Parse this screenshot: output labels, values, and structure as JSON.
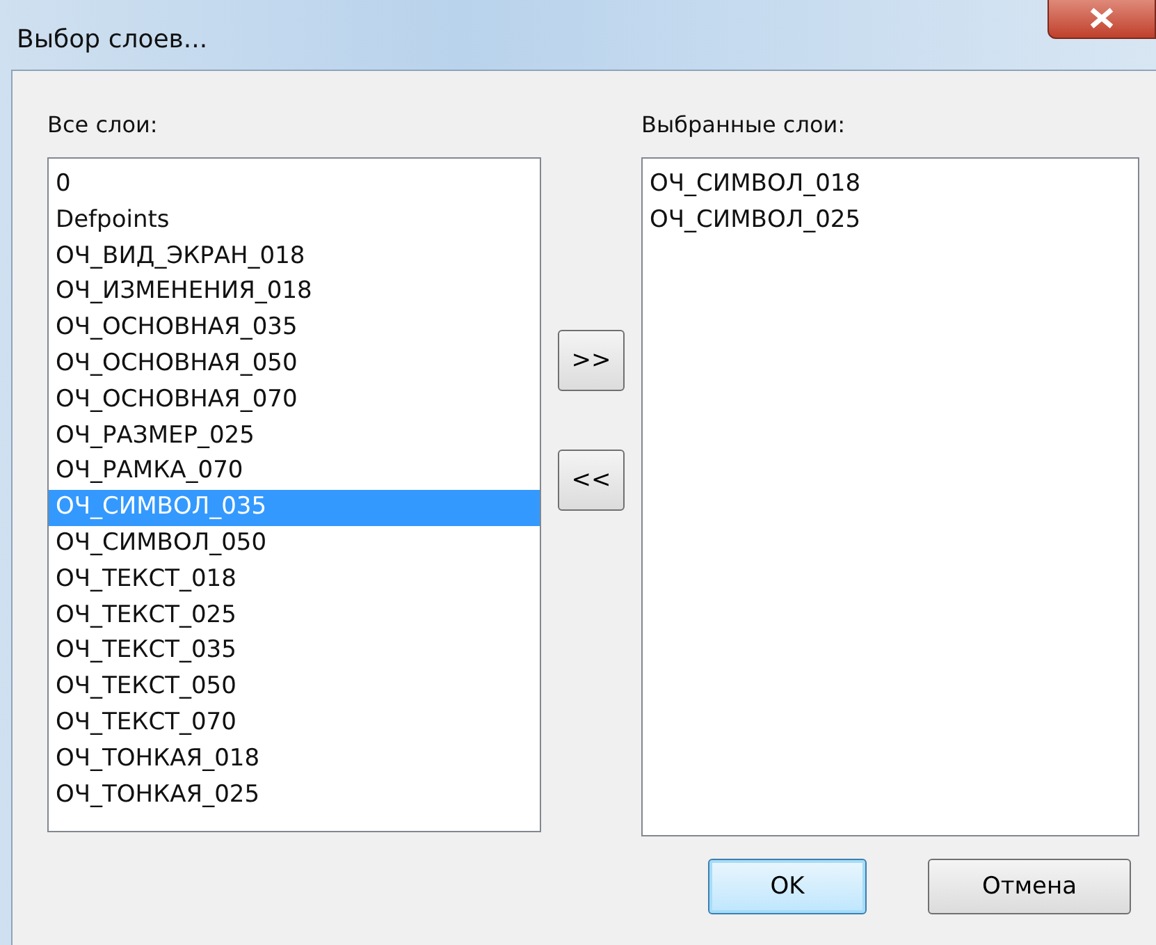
{
  "window": {
    "title": "Выбор слоев..."
  },
  "all_layers": {
    "label": "Все слои:",
    "items": [
      {
        "name": "0",
        "selected": false
      },
      {
        "name": "Defpoints",
        "selected": false
      },
      {
        "name": "ОЧ_ВИД_ЭКРАН_018",
        "selected": false
      },
      {
        "name": "ОЧ_ИЗМЕНЕНИЯ_018",
        "selected": false
      },
      {
        "name": "ОЧ_ОСНОВНАЯ_035",
        "selected": false
      },
      {
        "name": "ОЧ_ОСНОВНАЯ_050",
        "selected": false
      },
      {
        "name": "ОЧ_ОСНОВНАЯ_070",
        "selected": false
      },
      {
        "name": "ОЧ_РАЗМЕР_025",
        "selected": false
      },
      {
        "name": "ОЧ_РАМКА_070",
        "selected": false
      },
      {
        "name": "ОЧ_СИМВОЛ_035",
        "selected": true
      },
      {
        "name": "ОЧ_СИМВОЛ_050",
        "selected": false
      },
      {
        "name": "ОЧ_ТЕКСТ_018",
        "selected": false
      },
      {
        "name": "ОЧ_ТЕКСТ_025",
        "selected": false
      },
      {
        "name": "ОЧ_ТЕКСТ_035",
        "selected": false
      },
      {
        "name": "ОЧ_ТЕКСТ_050",
        "selected": false
      },
      {
        "name": "ОЧ_ТЕКСТ_070",
        "selected": false
      },
      {
        "name": "ОЧ_ТОНКАЯ_018",
        "selected": false
      },
      {
        "name": "ОЧ_ТОНКАЯ_025",
        "selected": false
      }
    ]
  },
  "move_buttons": [
    ">>",
    "<<"
  ],
  "selected_layers": {
    "label": "Выбранные слои:",
    "items": [
      {
        "name": "ОЧ_СИМВОЛ_018",
        "selected": false
      },
      {
        "name": "ОЧ_СИМВОЛ_025",
        "selected": false
      }
    ]
  },
  "buttons": [
    {
      "label": "OK",
      "default": true
    },
    {
      "label": "Отмена",
      "default": false
    }
  ]
}
